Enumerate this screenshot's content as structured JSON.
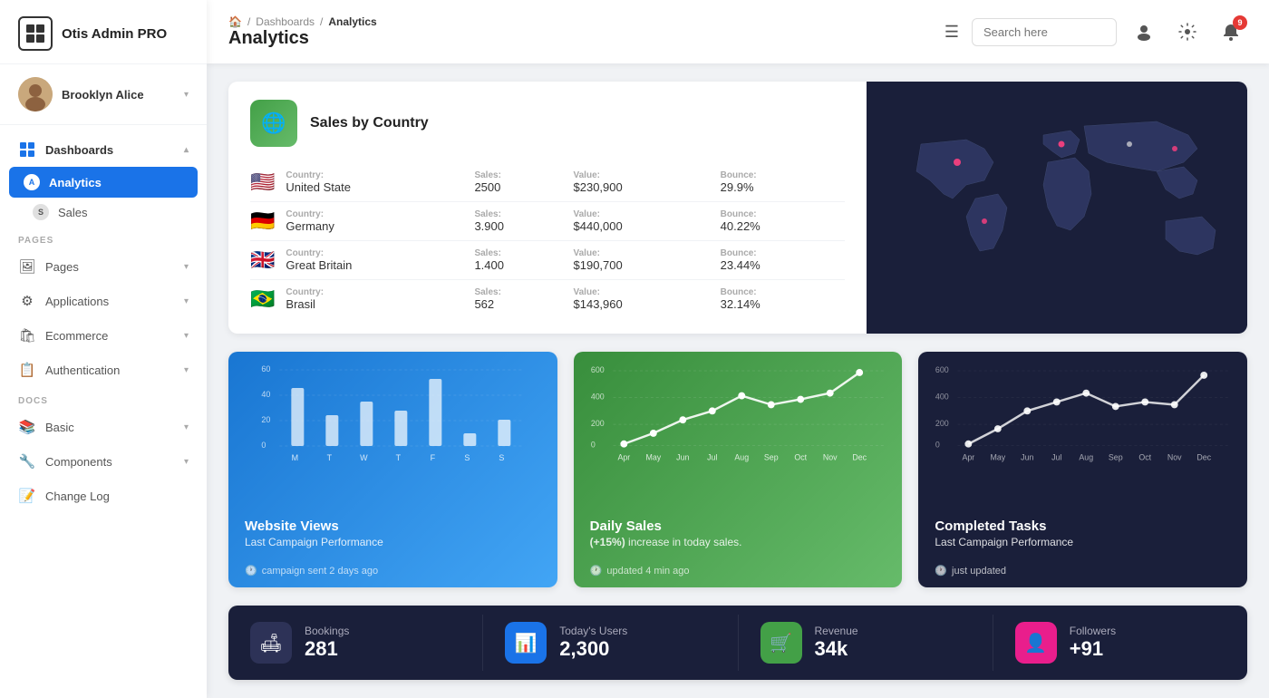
{
  "app": {
    "name": "Otis Admin PRO"
  },
  "user": {
    "name": "Brooklyn Alice"
  },
  "sidebar": {
    "dashboards_label": "Dashboards",
    "analytics_label": "Analytics",
    "sales_label": "Sales",
    "pages_section": "PAGES",
    "pages_label": "Pages",
    "applications_label": "Applications",
    "ecommerce_label": "Ecommerce",
    "authentication_label": "Authentication",
    "docs_section": "DOCS",
    "basic_label": "Basic",
    "components_label": "Components",
    "changelog_label": "Change Log"
  },
  "header": {
    "home_icon": "🏠",
    "breadcrumb_sep": "/",
    "breadcrumb_dashboards": "Dashboards",
    "breadcrumb_analytics": "Analytics",
    "page_title": "Analytics",
    "menu_icon": "☰",
    "search_placeholder": "Search here",
    "notif_count": "9"
  },
  "sales_by_country": {
    "title": "Sales by Country",
    "columns": {
      "country": "Country:",
      "sales": "Sales:",
      "value": "Value:",
      "bounce": "Bounce:"
    },
    "rows": [
      {
        "flag": "🇺🇸",
        "country": "United State",
        "sales": "2500",
        "value": "$230,900",
        "bounce": "29.9%"
      },
      {
        "flag": "🇩🇪",
        "country": "Germany",
        "sales": "3.900",
        "value": "$440,000",
        "bounce": "40.22%"
      },
      {
        "flag": "🇬🇧",
        "country": "Great Britain",
        "sales": "1.400",
        "value": "$190,700",
        "bounce": "23.44%"
      },
      {
        "flag": "🇧🇷",
        "country": "Brasil",
        "sales": "562",
        "value": "$143,960",
        "bounce": "32.14%"
      }
    ]
  },
  "website_views": {
    "title": "Website Views",
    "subtitle": "Last Campaign Performance",
    "footer": "campaign sent 2 days ago",
    "y_labels": [
      "60",
      "40",
      "20",
      "0"
    ],
    "x_labels": [
      "M",
      "T",
      "W",
      "T",
      "F",
      "S",
      "S"
    ]
  },
  "daily_sales": {
    "title": "Daily Sales",
    "highlight": "(+15%)",
    "subtitle": "increase in today sales.",
    "footer": "updated 4 min ago",
    "y_labels": [
      "600",
      "400",
      "200",
      "0"
    ],
    "x_labels": [
      "Apr",
      "May",
      "Jun",
      "Jul",
      "Aug",
      "Sep",
      "Oct",
      "Nov",
      "Dec"
    ]
  },
  "completed_tasks": {
    "title": "Completed Tasks",
    "subtitle": "Last Campaign Performance",
    "footer": "just updated",
    "y_labels": [
      "600",
      "400",
      "200",
      "0"
    ],
    "x_labels": [
      "Apr",
      "May",
      "Jun",
      "Jul",
      "Aug",
      "Sep",
      "Oct",
      "Nov",
      "Dec"
    ]
  },
  "stats": [
    {
      "icon": "🛋",
      "icon_class": "dark-icon",
      "label": "Bookings",
      "value": "281"
    },
    {
      "icon": "📊",
      "icon_class": "blue-icon",
      "label": "Today's Users",
      "value": "2,300"
    },
    {
      "icon": "🛒",
      "icon_class": "green-icon",
      "label": "Revenue",
      "value": "34k"
    },
    {
      "icon": "👤",
      "icon_class": "pink-icon",
      "label": "Followers",
      "value": "+91"
    }
  ]
}
